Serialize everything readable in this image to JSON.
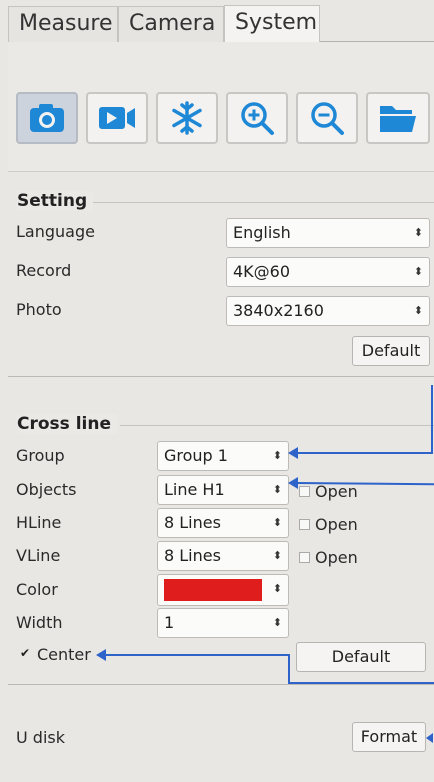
{
  "tabs": [
    {
      "label": "Measure"
    },
    {
      "label": "Camera"
    },
    {
      "label": "System",
      "active": true
    }
  ],
  "toolbar": {
    "buttons": [
      {
        "icon": "camera-icon",
        "active": true
      },
      {
        "icon": "video-camera-icon"
      },
      {
        "icon": "snowflake-icon"
      },
      {
        "icon": "zoom-in-icon"
      },
      {
        "icon": "zoom-out-icon"
      },
      {
        "icon": "folder-icon"
      }
    ]
  },
  "setting": {
    "title": "Setting",
    "language": {
      "label": "Language",
      "value": "English"
    },
    "record": {
      "label": "Record",
      "value": "4K@60"
    },
    "photo": {
      "label": "Photo",
      "value": "3840x2160"
    },
    "default_label": "Default"
  },
  "crossline": {
    "title": "Cross line",
    "group": {
      "label": "Group",
      "value": "Group 1"
    },
    "objects": {
      "label": "Objects",
      "value": "Line H1",
      "open_label": "Open"
    },
    "hline": {
      "label": "HLine",
      "value": "8 Lines",
      "open_label": "Open"
    },
    "vline": {
      "label": "VLine",
      "value": "8 Lines",
      "open_label": "Open"
    },
    "color": {
      "label": "Color",
      "value_color": "#e01d1d"
    },
    "width": {
      "label": "Width",
      "value": "1"
    },
    "center": {
      "label": "Center",
      "checked": true
    },
    "default_label": "Default"
  },
  "udisk": {
    "label": "U disk",
    "format_label": "Format"
  },
  "colors": {
    "accent": "#1e88d6",
    "annotation": "#2e63c9"
  }
}
